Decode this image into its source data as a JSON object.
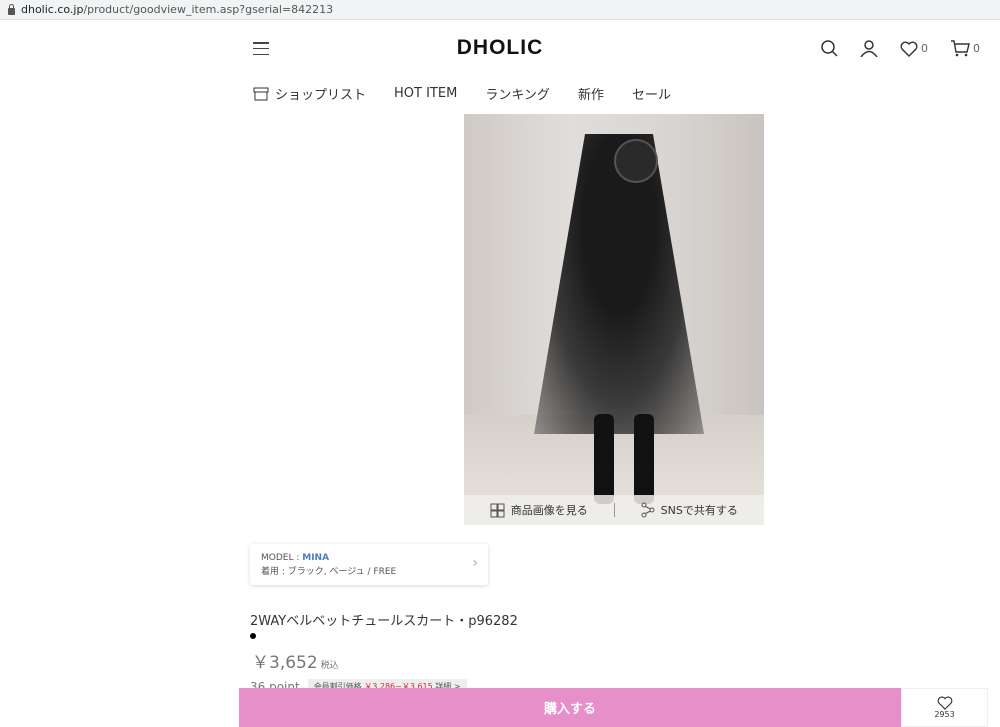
{
  "browser": {
    "url_domain": "dholic.co.jp",
    "url_path": "/product/goodview_item.asp?gserial=842213"
  },
  "header": {
    "logo": "DHOLIC",
    "wishlist_count": "0",
    "cart_count": "0"
  },
  "nav": {
    "items": [
      "ショップリスト",
      "HOT ITEM",
      "ランキング",
      "新作",
      "セール"
    ]
  },
  "photo": {
    "view_images": "商品画像を見る",
    "share_sns": "SNSで共有する"
  },
  "model": {
    "label": "MODEL : ",
    "name": "MINA",
    "wearing": "着用 : ブラック, ベージュ / FREE"
  },
  "product": {
    "title": "2WAYベルベットチュールスカート・p96282",
    "price": "￥3,652",
    "tax": "税込",
    "points": "36 point",
    "member_label": "会員割引価格 ",
    "member_price": "￥3,286~￥3,615",
    "member_detail": " 詳細 >"
  },
  "actions": {
    "buy": "購入する",
    "like_count": "2953"
  },
  "colors": {
    "buy": "#e68fc8",
    "model_name": "#4a7fc0"
  }
}
